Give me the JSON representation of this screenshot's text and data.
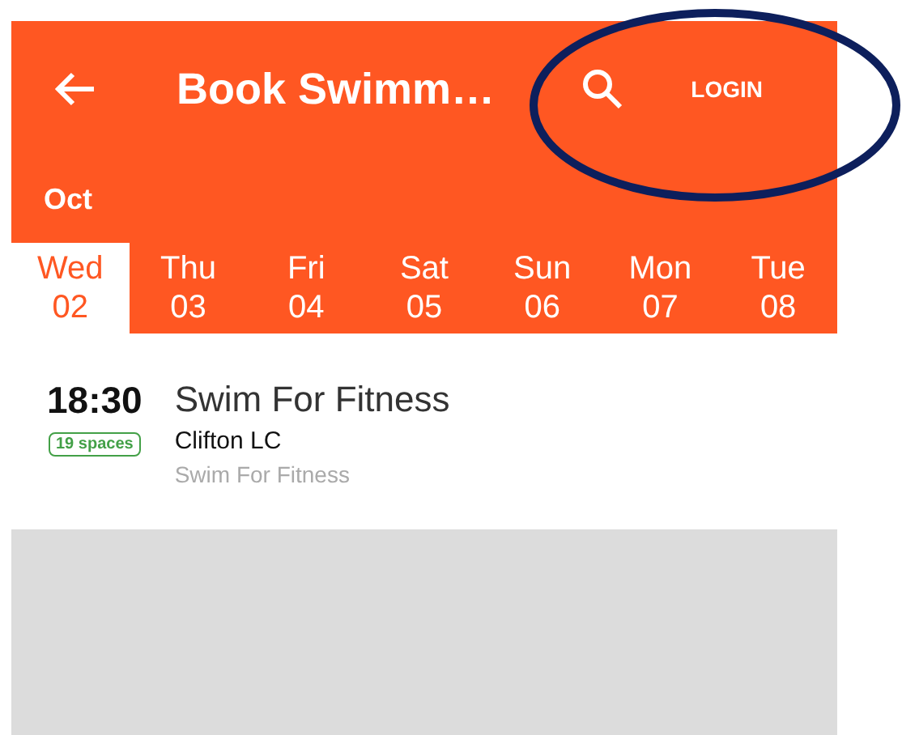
{
  "toolbar": {
    "title": "Book Swimm…",
    "action": "LOGIN"
  },
  "month": "Oct",
  "days": [
    {
      "weekday": "Wed",
      "date": "02",
      "selected": true
    },
    {
      "weekday": "Thu",
      "date": "03",
      "selected": false
    },
    {
      "weekday": "Fri",
      "date": "04",
      "selected": false
    },
    {
      "weekday": "Sat",
      "date": "05",
      "selected": false
    },
    {
      "weekday": "Sun",
      "date": "06",
      "selected": false
    },
    {
      "weekday": "Mon",
      "date": "07",
      "selected": false
    },
    {
      "weekday": "Tue",
      "date": "08",
      "selected": false
    }
  ],
  "sessions": [
    {
      "time": "18:30",
      "spaces": "19 spaces",
      "title": "Swim For Fitness",
      "venue": "Clifton LC",
      "category": "Swim For Fitness"
    }
  ]
}
